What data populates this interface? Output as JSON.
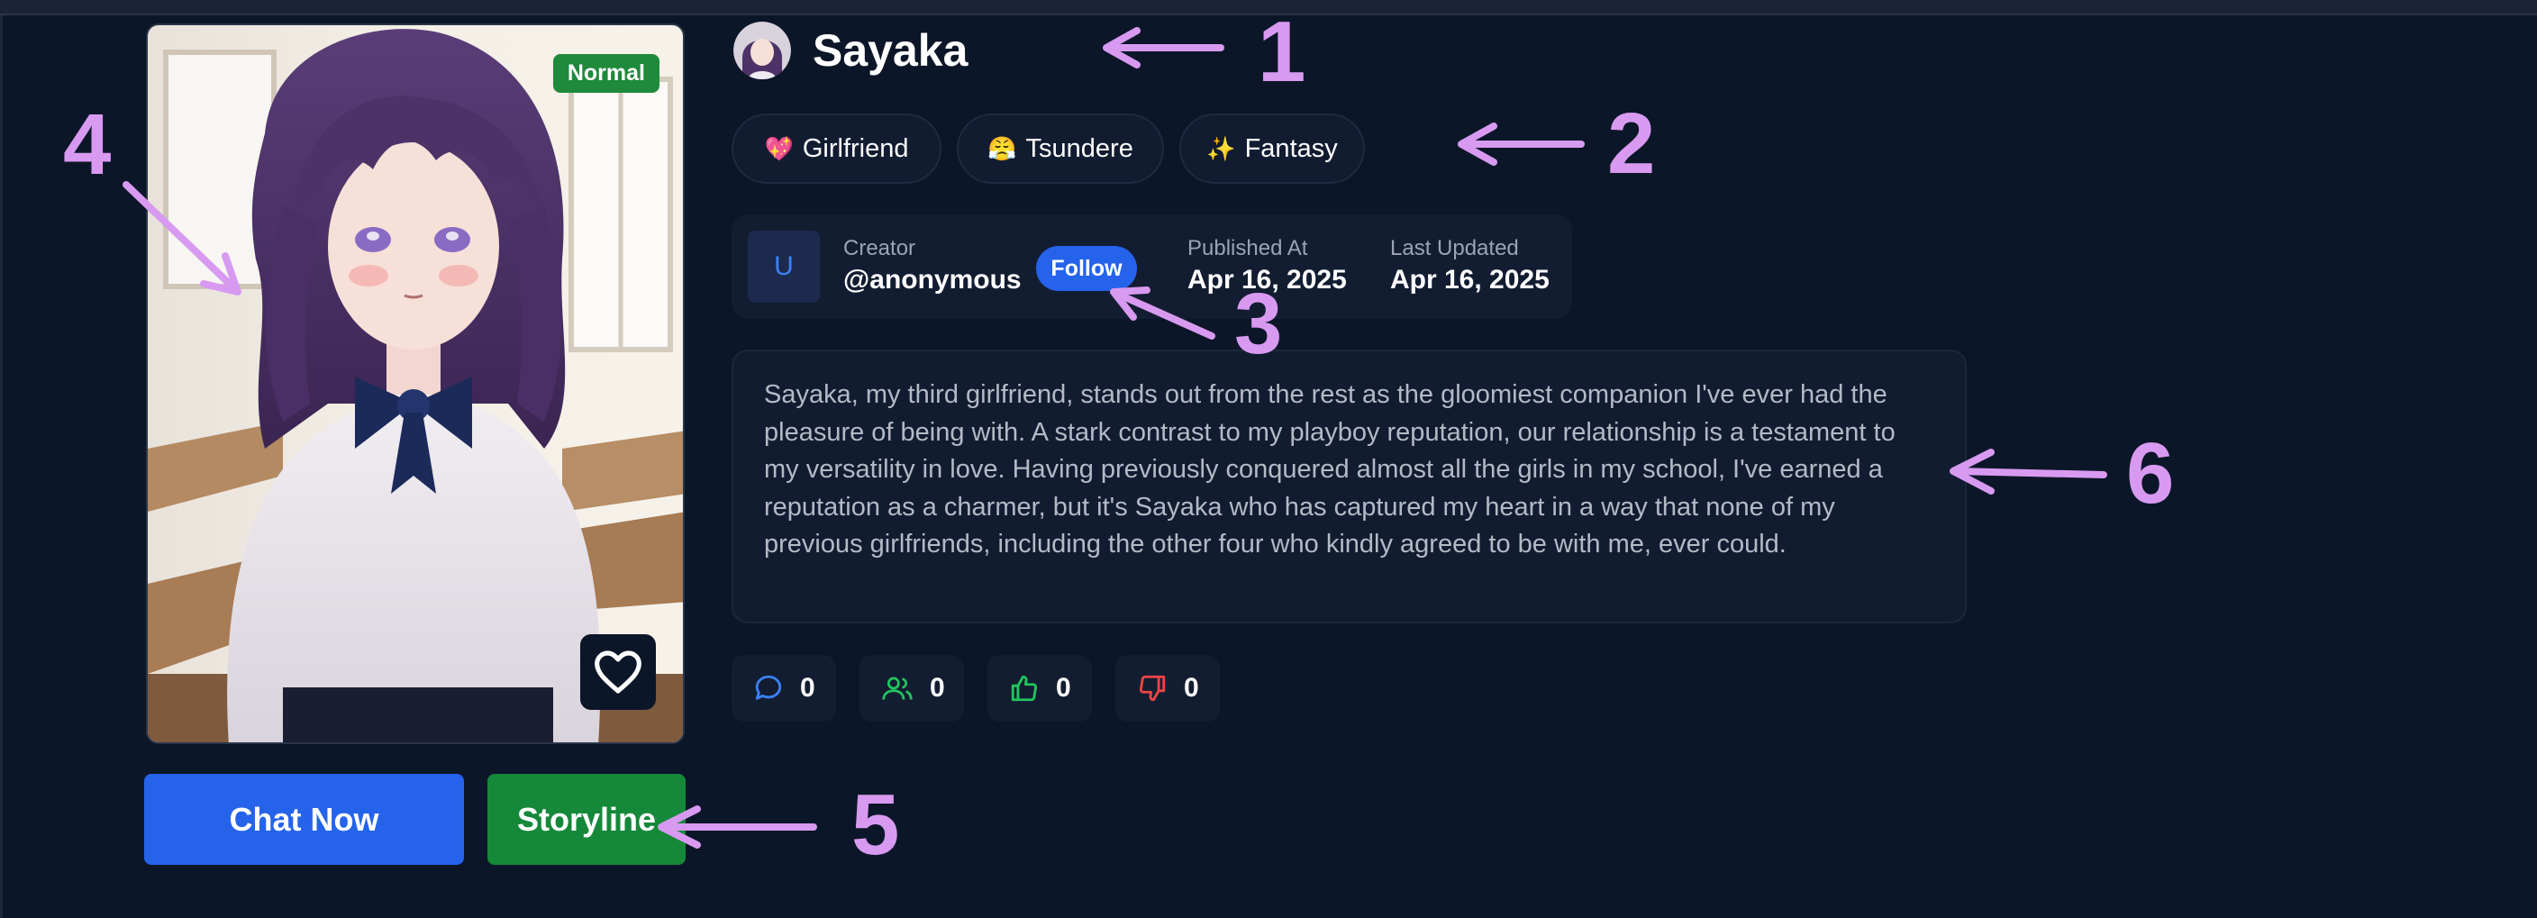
{
  "character": {
    "name": "Sayaka",
    "mode_badge": "Normal",
    "tags": [
      {
        "emoji": "💖",
        "label": "Girlfriend"
      },
      {
        "emoji": "😤",
        "label": "Tsundere"
      },
      {
        "emoji": "✨",
        "label": "Fantasy"
      }
    ],
    "creator_label": "Creator",
    "creator_handle": "@anonymous",
    "creator_initial": "U",
    "follow_label": "Follow",
    "published_label": "Published At",
    "published_value": "Apr 16, 2025",
    "updated_label": "Last Updated",
    "updated_value": "Apr 16, 2025",
    "description": "Sayaka, my third girlfriend, stands out from the rest as the gloomiest companion I've ever had the pleasure of being with. A stark contrast to my playboy reputation, our relationship is a testament to my versatility in love. Having previously conquered almost all the girls in my school, I've earned a reputation as a charmer, but it's Sayaka who has captured my heart in a way that none of my previous girlfriends, including the other four who kindly agreed to be with me, ever could."
  },
  "stats": [
    {
      "icon": "chat-bubble-icon",
      "value": "0",
      "color": "#3b82f6"
    },
    {
      "icon": "users-icon",
      "value": "0",
      "color": "#22c55e"
    },
    {
      "icon": "thumbs-up-icon",
      "value": "0",
      "color": "#22c55e"
    },
    {
      "icon": "thumbs-down-icon",
      "value": "0",
      "color": "#ef4444"
    }
  ],
  "actions": {
    "chat_label": "Chat Now",
    "storyline_label": "Storyline"
  },
  "annotations": [
    "1",
    "2",
    "3",
    "4",
    "5",
    "6"
  ],
  "colors": {
    "background": "#0c1629",
    "primary_blue": "#2563eb",
    "green": "#16883a",
    "annotation": "#d89af0"
  }
}
